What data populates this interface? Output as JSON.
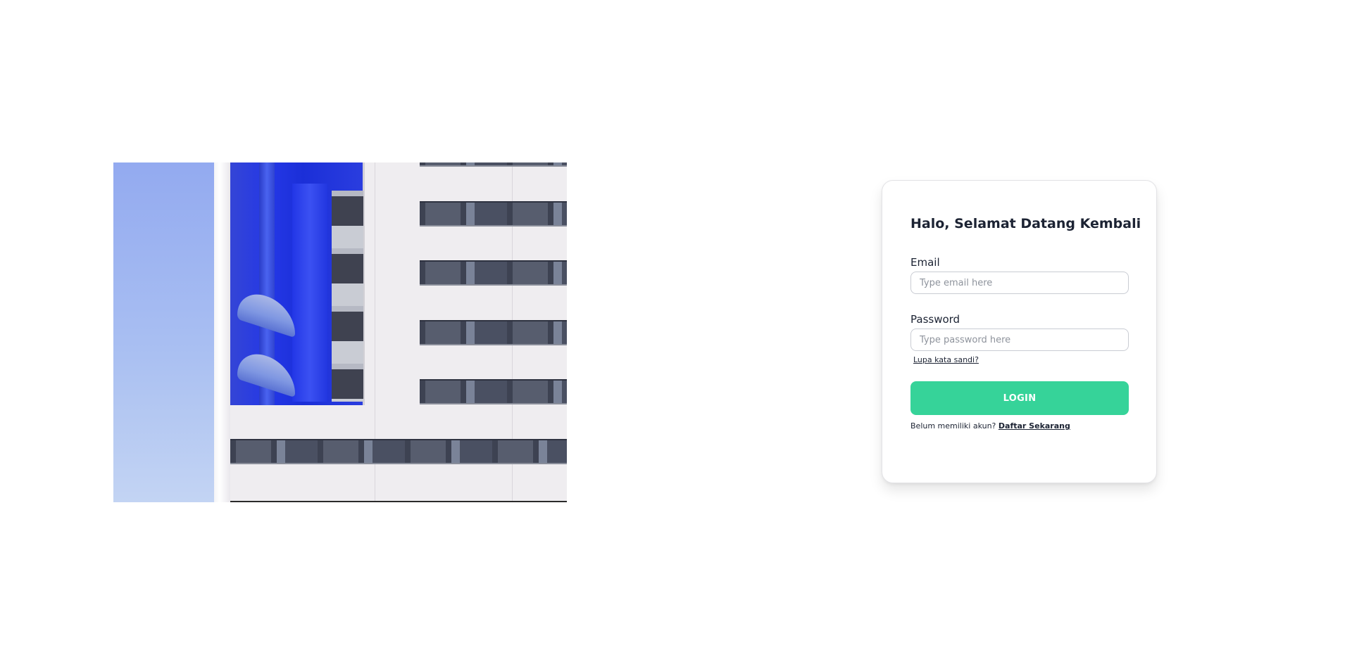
{
  "hero": {
    "image_subject": "building-facade-photo",
    "colors": {
      "sky": "#a9bff2",
      "accent_blue": "#2437e6",
      "facade": "#efedf0"
    }
  },
  "login_card": {
    "title": "Halo, Selamat Datang Kembali",
    "email": {
      "label": "Email",
      "placeholder": "Type email here",
      "value": ""
    },
    "password": {
      "label": "Password",
      "placeholder": "Type password here",
      "value": ""
    },
    "forgot_password_label": "Lupa kata sandi?",
    "login_button_label": "LOGIN",
    "signup_prompt": "Belum memiliki akun?",
    "signup_link_label": "Daftar Sekarang",
    "colors": {
      "button": "#36d399",
      "text": "#1c2333"
    }
  }
}
